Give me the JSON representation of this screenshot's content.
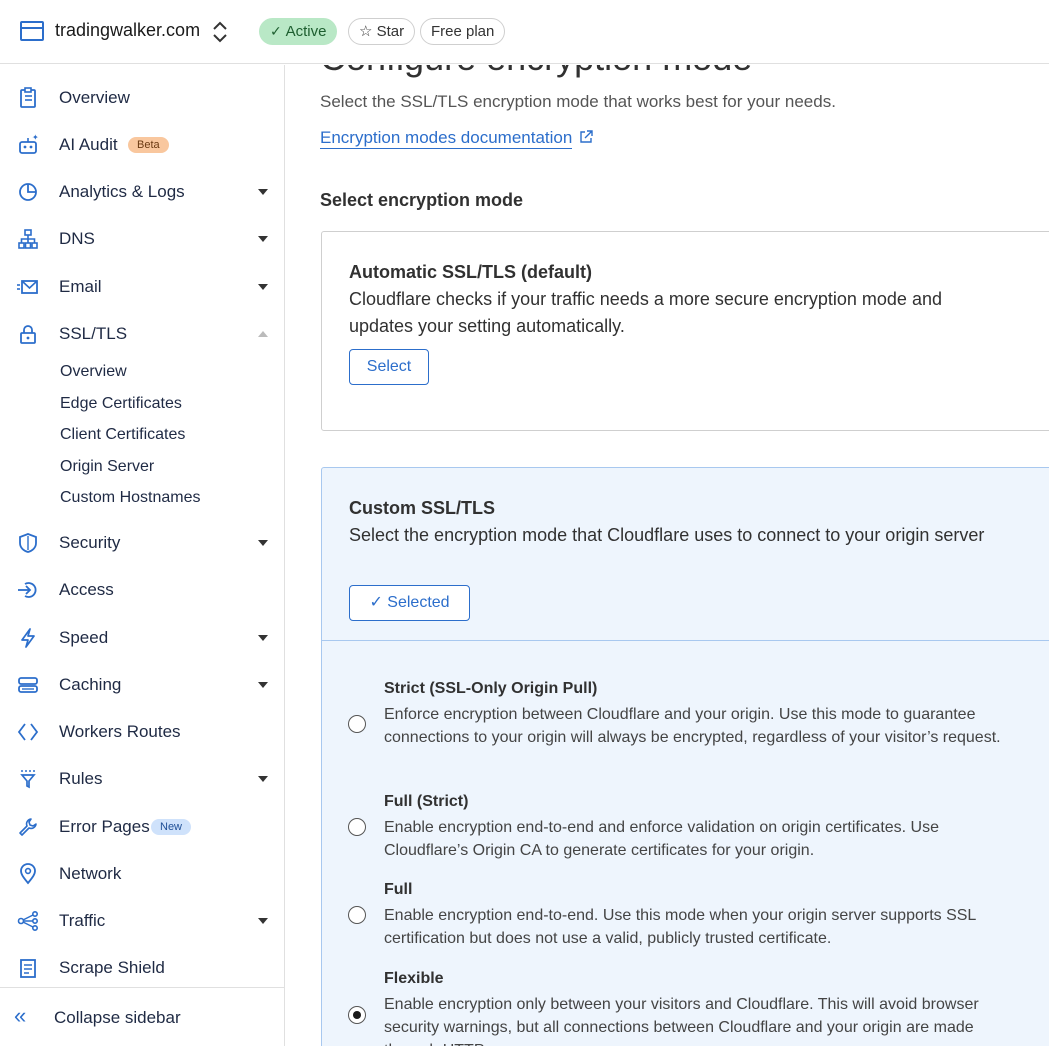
{
  "header": {
    "domain": "tradingwalker.com",
    "status_badge": "Active",
    "star_label": "Star",
    "plan_badge": "Free plan"
  },
  "sidebar": {
    "items": [
      {
        "label": "Overview",
        "icon": "clipboard-icon"
      },
      {
        "label": "AI Audit",
        "icon": "robot-icon",
        "badge": "Beta"
      },
      {
        "label": "Analytics & Logs",
        "icon": "pie-chart-icon"
      },
      {
        "label": "DNS",
        "icon": "network-tree-icon"
      },
      {
        "label": "Email",
        "icon": "envelope-icon"
      },
      {
        "label": "SSL/TLS",
        "icon": "lock-icon"
      },
      {
        "label": "Security",
        "icon": "shield-icon"
      },
      {
        "label": "Access",
        "icon": "access-icon"
      },
      {
        "label": "Speed",
        "icon": "lightning-icon"
      },
      {
        "label": "Caching",
        "icon": "server-icon"
      },
      {
        "label": "Workers Routes",
        "icon": "code-brackets-icon"
      },
      {
        "label": "Rules",
        "icon": "funnel-icon"
      },
      {
        "label": "Error Pages",
        "icon": "wrench-icon",
        "badge": "New"
      },
      {
        "label": "Network",
        "icon": "location-pin-icon"
      },
      {
        "label": "Traffic",
        "icon": "share-nodes-icon"
      },
      {
        "label": "Scrape Shield",
        "icon": "document-icon"
      }
    ],
    "ssl_subitems": [
      "Overview",
      "Edge Certificates",
      "Client Certificates",
      "Origin Server",
      "Custom Hostnames"
    ],
    "collapse_label": "Collapse sidebar"
  },
  "main": {
    "title": "Configure encryption mode",
    "subtitle": "Select the SSL/TLS encryption mode that works best for your needs.",
    "doc_link": "Encryption modes documentation",
    "section_title": "Select encryption mode",
    "auto_card": {
      "title": "Automatic SSL/TLS (default)",
      "description": "Cloudflare checks if your traffic needs a more secure encryption mode and updates your setting automatically.",
      "button": "Select"
    },
    "custom_card": {
      "title": "Custom SSL/TLS",
      "description": "Select the encryption mode that Cloudflare uses to connect to your origin server",
      "button": "Selected",
      "options": [
        {
          "title": "Strict (SSL-Only Origin Pull)",
          "description": "Enforce encryption between Cloudflare and your origin. Use this mode to guarantee connections to your origin will always be encrypted, regardless of your visitor’s request.",
          "selected": false
        },
        {
          "title": "Full (Strict)",
          "description": "Enable encryption end-to-end and enforce validation on origin certificates. Use Cloudflare’s Origin CA to generate certificates for your origin.",
          "selected": false
        },
        {
          "title": "Full",
          "description": "Enable encryption end-to-end. Use this mode when your origin server supports SSL certification but does not use a valid, publicly trusted certificate.",
          "selected": false
        },
        {
          "title": "Flexible",
          "description": "Enable encryption only between your visitors and Cloudflare. This will avoid browser security warnings, but all connections between Cloudflare and your origin are made through HTTP.",
          "selected": true
        }
      ]
    }
  },
  "colors": {
    "accent": "#2c6ecb",
    "active_badge": "#b9e8c6",
    "selected_card_bg": "#eef5fd"
  }
}
